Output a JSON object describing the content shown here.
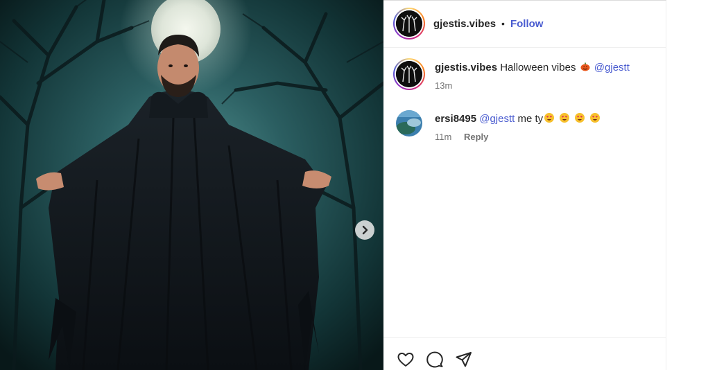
{
  "header": {
    "username": "gjestis.vibes",
    "separator": "•",
    "follow_label": "Follow"
  },
  "caption": {
    "username": "gjestis.vibes",
    "text": "Halloween vibes",
    "emoji": "pumpkin-emoji",
    "mention": "@gjestt",
    "time": "13m"
  },
  "comments": [
    {
      "username": "ersi8495",
      "mention": "@gjestt",
      "text": "me ty",
      "emojis": [
        "heart-eyes-emoji",
        "heart-eyes-emoji",
        "heart-eyes-emoji",
        "heart-eyes-emoji"
      ],
      "time": "11m",
      "reply_label": "Reply"
    }
  ],
  "media": {
    "next_icon": "chevron-right-icon"
  },
  "actions": {
    "icons": [
      "heart-icon",
      "comment-icon",
      "share-icon"
    ]
  },
  "colors": {
    "link": "#4a5cd0",
    "text": "#262626",
    "muted": "#737373",
    "scene_bg": "#0d2426"
  }
}
